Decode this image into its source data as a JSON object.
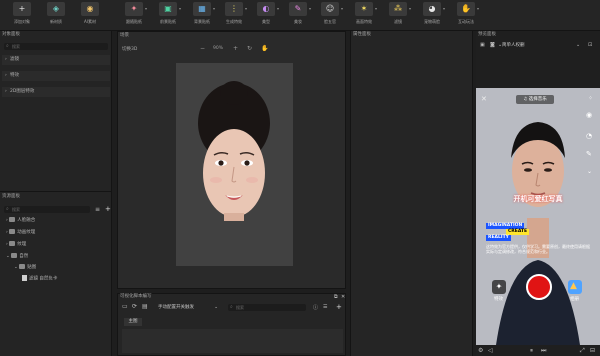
{
  "toolbar": [
    {
      "label": "添加对象",
      "icon": "plus-icon",
      "glyph": "+",
      "color": "#e6e6e6"
    },
    {
      "label": "新材质",
      "icon": "material-icon",
      "glyph": "◈",
      "color": "#6fd1c6"
    },
    {
      "label": "AI素材",
      "icon": "ai-asset-icon",
      "glyph": "◉",
      "color": "#f0c46a"
    },
    {
      "label": "跟随贴纸",
      "icon": "follow-sticker-icon",
      "glyph": "✦",
      "color": "#f28b9a"
    },
    {
      "label": "前景贴纸",
      "icon": "foreground-sticker-icon",
      "glyph": "▣",
      "color": "#4fd3a3"
    },
    {
      "label": "背景贴纸",
      "icon": "background-sticker-icon",
      "glyph": "▦",
      "color": "#69b7f2"
    },
    {
      "label": "生成特效",
      "icon": "generate-effect-icon",
      "glyph": "⋮",
      "color": "#f2e36b"
    },
    {
      "label": "美型",
      "icon": "reshape-icon",
      "glyph": "◐",
      "color": "#c58cf2"
    },
    {
      "label": "美妆",
      "icon": "makeup-icon",
      "glyph": "✎",
      "color": "#e98ae2"
    },
    {
      "label": "脸五官",
      "icon": "face-features-icon",
      "glyph": "☺",
      "color": "#e0e0e0"
    },
    {
      "label": "画面特效",
      "icon": "screen-effect-icon",
      "glyph": "✶",
      "color": "#f5dd62"
    },
    {
      "label": "滤镜",
      "icon": "filter-icon",
      "glyph": "⁂",
      "color": "#f4d25a"
    },
    {
      "label": "宠物萌脸",
      "icon": "pet-face-icon",
      "glyph": "◕",
      "color": "#e6e6e6"
    },
    {
      "label": "互动玩法",
      "icon": "interactive-icon",
      "glyph": "✋",
      "color": "#6ad0f2"
    }
  ],
  "left": {
    "title": "对象面板",
    "search_placeholder": "搜索",
    "sections": [
      "滤镜",
      "特效",
      "2D图层特效"
    ],
    "resource_title": "资源面板",
    "resource_search_placeholder": "搜索",
    "tree": [
      "人脸融合",
      "动画纹理",
      "纹理",
      "自然",
      "贴图",
      "滤镜  自然负卡"
    ]
  },
  "scene": {
    "title": "场景",
    "mode": "切换3D",
    "zoom": "90%"
  },
  "visual": {
    "title": "可视化脚本编写",
    "mode": "手动配置开关触发",
    "search_placeholder": "搜索",
    "tab": "主图"
  },
  "property": {
    "title": "属性面板"
  },
  "preview": {
    "title": "预览面板",
    "device": "简单人权删",
    "choose_music": "选择音乐",
    "overlay_title": "开机可爱红写真",
    "tag1": "IMAGINATION",
    "tag2": "CREATE",
    "tag3": "REALITY",
    "desc": "这特效为官方提供，仅供学习。需要原创，最终使用请根据实际与定调修改，符合规范和行业。",
    "left_btn": "特效",
    "right_btn": "相册"
  }
}
